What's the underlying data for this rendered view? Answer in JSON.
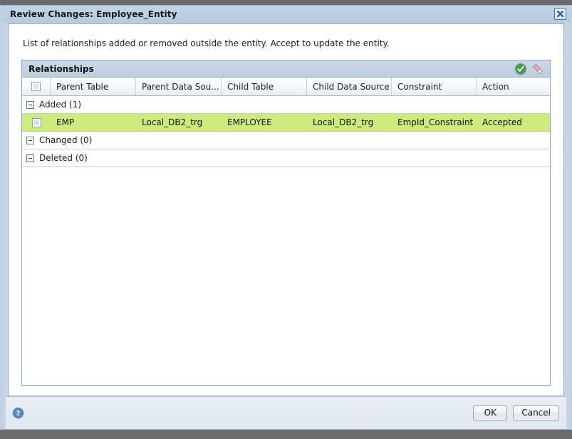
{
  "window": {
    "title": "Review Changes: Employee_Entity",
    "close_icon": "close-x-icon"
  },
  "content": {
    "description": "List of relationships added or removed outside the entity. Accept to update the entity."
  },
  "grid": {
    "panel_title": "Relationships",
    "tools": [
      {
        "name": "accept-icon",
        "label": "Accept"
      },
      {
        "name": "reject-icon",
        "label": "Reject"
      }
    ],
    "columns": [
      {
        "label": ""
      },
      {
        "label": "Parent Table"
      },
      {
        "label": "Parent Data Sou..."
      },
      {
        "label": "Child Table"
      },
      {
        "label": "Child Data Source"
      },
      {
        "label": "Constraint"
      },
      {
        "label": "Action"
      }
    ],
    "groups": [
      {
        "label": "Added (1)",
        "expanded": true,
        "rows": [
          {
            "checked": false,
            "parent_table": "EMP",
            "parent_data_source": "Local_DB2_trg",
            "child_table": "EMPLOYEE",
            "child_data_source": "Local_DB2_trg",
            "constraint": "EmpId_Constraint",
            "action": "Accepted",
            "highlight": "#cbeb7c"
          }
        ]
      },
      {
        "label": "Changed (0)",
        "expanded": true,
        "rows": []
      },
      {
        "label": "Deleted (0)",
        "expanded": true,
        "rows": []
      }
    ]
  },
  "footer": {
    "help_icon": "help-question-icon",
    "ok_label": "OK",
    "cancel_label": "Cancel"
  }
}
